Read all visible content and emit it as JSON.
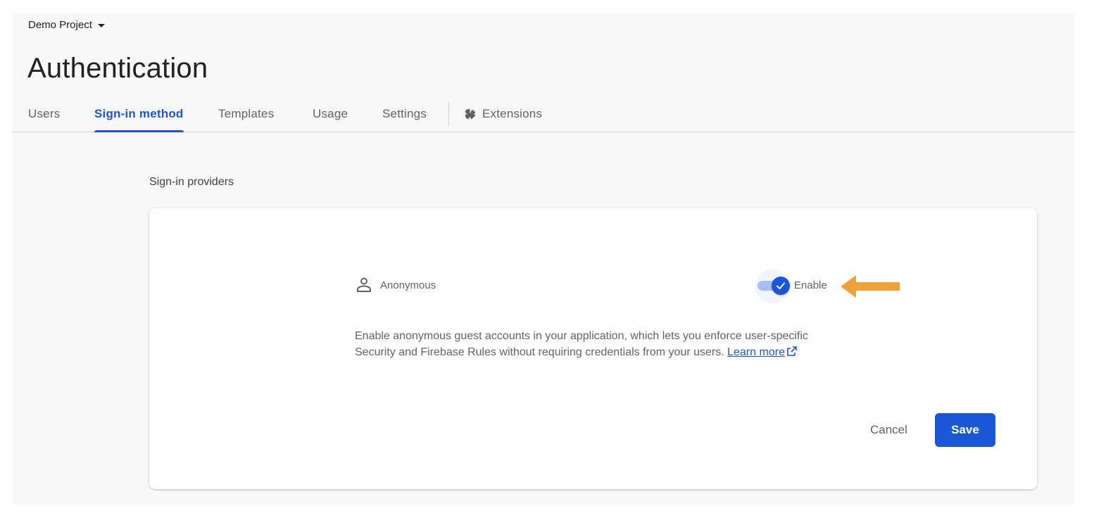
{
  "header": {
    "project_name": "Demo Project",
    "title": "Authentication"
  },
  "tabs": [
    {
      "label": "Users",
      "active": false
    },
    {
      "label": "Sign-in method",
      "active": true
    },
    {
      "label": "Templates",
      "active": false
    },
    {
      "label": "Usage",
      "active": false
    },
    {
      "label": "Settings",
      "active": false
    },
    {
      "label": "Extensions",
      "active": false,
      "icon": "extensions-puzzle-icon"
    }
  ],
  "section": {
    "label": "Sign-in providers"
  },
  "provider": {
    "icon": "person-icon",
    "name": "Anonymous",
    "enabled": true,
    "toggle_label": "Enable",
    "description": "Enable anonymous guest accounts in your application, which lets you enforce user-specific Security and Firebase Rules without requiring credentials from your users.",
    "learn_more": "Learn more"
  },
  "actions": {
    "cancel_label": "Cancel",
    "save_label": "Save"
  },
  "colors": {
    "accent": "#1a56d6",
    "annotation_arrow": "#f0a23a",
    "page_background": "#f8f8f8"
  }
}
